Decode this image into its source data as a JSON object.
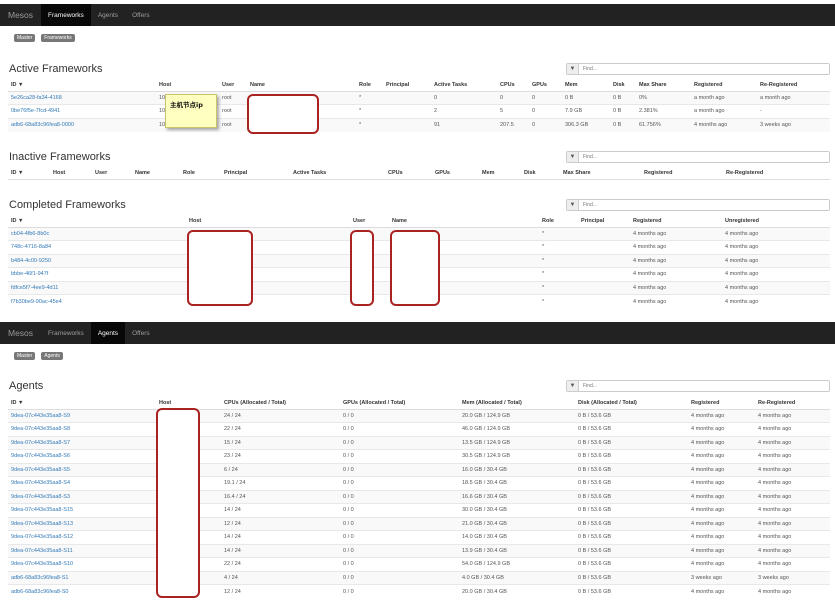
{
  "screen1": {
    "navbar": {
      "brand": "Mesos",
      "items": [
        "Frameworks",
        "Agents",
        "Offers"
      ],
      "active": "Frameworks"
    },
    "breadcrumbs": [
      "Master",
      "Frameworks"
    ],
    "active": {
      "title": "Active Frameworks",
      "filter_placeholder": "Find...",
      "columns": [
        "ID ▼",
        "Host",
        "User",
        "Name",
        "Role",
        "Principal",
        "Active Tasks",
        "CPUs",
        "GPUs",
        "Mem",
        "Disk",
        "Max Share",
        "Registered",
        "Re-Registered"
      ],
      "rows": [
        [
          "5e26ca28-fa34-4168",
          "10",
          "root",
          "",
          "*",
          "",
          "0",
          "0",
          "0",
          "0 B",
          "0 B",
          "0%",
          "a month ago",
          "a month ago"
        ],
        [
          "0be76f5e-7fcd-4941",
          "10",
          "root",
          "",
          "*",
          "",
          "2",
          "5",
          "0",
          "7.9 GB",
          "0 B",
          "2.381%",
          "a month ago",
          "-"
        ],
        [
          "adb6-68a83c96fea8-0000",
          "10",
          "root",
          "",
          "*",
          "",
          "91",
          "207.5",
          "0",
          "306.3 GB",
          "0 B",
          "61.756%",
          "4 months ago",
          "3 weeks ago"
        ]
      ]
    },
    "inactive": {
      "title": "Inactive Frameworks",
      "filter_placeholder": "Find...",
      "columns": [
        "ID ▼",
        "Host",
        "User",
        "Name",
        "Role",
        "Principal",
        "Active Tasks",
        "CPUs",
        "GPUs",
        "Mem",
        "Disk",
        "Max Share",
        "Registered",
        "Re-Registered"
      ]
    },
    "completed": {
      "title": "Completed Frameworks",
      "filter_placeholder": "Find...",
      "columns": [
        "ID ▼",
        "Host",
        "User",
        "Name",
        "Role",
        "Principal",
        "Registered",
        "Unregistered"
      ],
      "rows": [
        [
          "cb04-4fb6-8b0c",
          "",
          "",
          "",
          "*",
          "",
          "4 months ago",
          "4 months ago"
        ],
        [
          "748c-4716-8a84",
          "",
          "",
          "",
          "*",
          "",
          "4 months ago",
          "4 months ago"
        ],
        [
          "b484-4c00-9250",
          "",
          "",
          "",
          "*",
          "",
          "4 months ago",
          "4 months ago"
        ],
        [
          "bbbe-46f1-947f",
          "",
          "",
          "",
          "*",
          "",
          "4 months ago",
          "4 months ago"
        ],
        [
          "fdfce5f7-4ee9-4d11",
          "",
          "",
          "",
          "*",
          "",
          "4 months ago",
          "4 months ago"
        ],
        [
          "f7b30be9-90ac-45e4",
          "",
          "",
          "",
          "*",
          "",
          "4 months ago",
          "4 months ago"
        ]
      ]
    },
    "sticky_note": "主机节点ip"
  },
  "screen2": {
    "navbar": {
      "brand": "Mesos",
      "items": [
        "Frameworks",
        "Agents",
        "Offers"
      ],
      "active": "Agents"
    },
    "breadcrumbs": [
      "Master",
      "Agents"
    ],
    "agents": {
      "title": "Agents",
      "filter_placeholder": "Find...",
      "columns": [
        "ID ▼",
        "Host",
        "CPUs (Allocated / Total)",
        "GPUs (Allocated / Total)",
        "Mem (Allocated / Total)",
        "Disk (Allocated / Total)",
        "Registered",
        "Re-Registered"
      ],
      "rows": [
        [
          "9dea-07c443e35aa8-S9",
          "",
          "24 / 24",
          "0 / 0",
          "20.0 GB / 124.9 GB",
          "0 B / 53.6 GB",
          "4 months ago",
          "4 months ago"
        ],
        [
          "9dea-07c443e35aa8-S8",
          "",
          "22 / 24",
          "0 / 0",
          "46.0 GB / 124.9 GB",
          "0 B / 53.6 GB",
          "4 months ago",
          "4 months ago"
        ],
        [
          "9dea-07c443e35aa8-S7",
          "",
          "15 / 24",
          "0 / 0",
          "13.5 GB / 124.9 GB",
          "0 B / 53.6 GB",
          "4 months ago",
          "4 months ago"
        ],
        [
          "9dea-07c443e35aa8-S6",
          "",
          "23 / 24",
          "0 / 0",
          "30.5 GB / 124.9 GB",
          "0 B / 53.6 GB",
          "4 months ago",
          "4 months ago"
        ],
        [
          "9dea-07c443e35aa8-S5",
          "",
          "6 / 24",
          "0 / 0",
          "16.0 GB / 30.4 GB",
          "0 B / 53.6 GB",
          "4 months ago",
          "4 months ago"
        ],
        [
          "9dea-07c443e35aa8-S4",
          "",
          "19.1 / 24",
          "0 / 0",
          "18.5 GB / 30.4 GB",
          "0 B / 53.6 GB",
          "4 months ago",
          "4 months ago"
        ],
        [
          "9dea-07c443e35aa8-S3",
          "",
          "16.4 / 24",
          "0 / 0",
          "16.6 GB / 30.4 GB",
          "0 B / 53.6 GB",
          "4 months ago",
          "4 months ago"
        ],
        [
          "9dea-07c443e35aa8-S15",
          "",
          "14 / 24",
          "0 / 0",
          "30.0 GB / 30.4 GB",
          "0 B / 53.6 GB",
          "4 months ago",
          "4 months ago"
        ],
        [
          "9dea-07c443e35aa8-S13",
          "",
          "12 / 24",
          "0 / 0",
          "21.0 GB / 30.4 GB",
          "0 B / 53.6 GB",
          "4 months ago",
          "4 months ago"
        ],
        [
          "9dea-07c443e35aa8-S12",
          "",
          "14 / 24",
          "0 / 0",
          "14.0 GB / 30.4 GB",
          "0 B / 53.6 GB",
          "4 months ago",
          "4 months ago"
        ],
        [
          "9dea-07c443e35aa8-S11",
          "",
          "14 / 24",
          "0 / 0",
          "13.9 GB / 30.4 GB",
          "0 B / 53.6 GB",
          "4 months ago",
          "4 months ago"
        ],
        [
          "9dea-07c443e35aa8-S10",
          "",
          "22 / 24",
          "0 / 0",
          "54.0 GB / 124.9 GB",
          "0 B / 53.6 GB",
          "4 months ago",
          "4 months ago"
        ],
        [
          "adb6-68a83c96fea8-S1",
          "",
          "4 / 24",
          "0 / 0",
          "4.0 GB / 30.4 GB",
          "0 B / 53.6 GB",
          "3 weeks ago",
          "3 weeks ago"
        ],
        [
          "adb6-68a83c96fea8-S0",
          "",
          "12 / 24",
          "0 / 0",
          "20.0 GB / 30.4 GB",
          "0 B / 53.6 GB",
          "4 months ago",
          "4 months ago"
        ]
      ]
    }
  }
}
